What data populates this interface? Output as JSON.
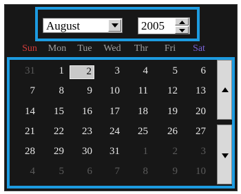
{
  "header": {
    "month": "August",
    "year": "2005"
  },
  "weekdays": [
    {
      "label": "Sun",
      "color": "#d23b3b"
    },
    {
      "label": "Mon",
      "color": "#a0a0a0"
    },
    {
      "label": "Tue",
      "color": "#a0a0a0"
    },
    {
      "label": "Wed",
      "color": "#a0a0a0"
    },
    {
      "label": "Thr",
      "color": "#a0a0a0"
    },
    {
      "label": "Fri",
      "color": "#a0a0a0"
    },
    {
      "label": "Sat",
      "color": "#7a62d6"
    }
  ],
  "calendar": {
    "selected_day": "2",
    "weeks": [
      [
        {
          "day": "31",
          "other": true
        },
        {
          "day": "1"
        },
        {
          "day": "2",
          "selected": true
        },
        {
          "day": "3"
        },
        {
          "day": "4"
        },
        {
          "day": "5"
        },
        {
          "day": "6"
        }
      ],
      [
        {
          "day": "7"
        },
        {
          "day": "8"
        },
        {
          "day": "9"
        },
        {
          "day": "10"
        },
        {
          "day": "11"
        },
        {
          "day": "12"
        },
        {
          "day": "13"
        }
      ],
      [
        {
          "day": "14"
        },
        {
          "day": "15"
        },
        {
          "day": "16"
        },
        {
          "day": "17"
        },
        {
          "day": "18"
        },
        {
          "day": "19"
        },
        {
          "day": "20"
        }
      ],
      [
        {
          "day": "21"
        },
        {
          "day": "22"
        },
        {
          "day": "23"
        },
        {
          "day": "24"
        },
        {
          "day": "25"
        },
        {
          "day": "26"
        },
        {
          "day": "27"
        }
      ],
      [
        {
          "day": "28"
        },
        {
          "day": "29"
        },
        {
          "day": "30"
        },
        {
          "day": "31"
        },
        {
          "day": "1",
          "other": true
        },
        {
          "day": "2",
          "other": true
        },
        {
          "day": "3",
          "other": true
        }
      ],
      [
        {
          "day": "4",
          "other": true
        },
        {
          "day": "5",
          "other": true
        },
        {
          "day": "6",
          "other": true
        },
        {
          "day": "7",
          "other": true
        },
        {
          "day": "8",
          "other": true
        },
        {
          "day": "9",
          "other": true
        },
        {
          "day": "10",
          "other": true
        }
      ]
    ]
  },
  "icons": {
    "month_dropdown": "chevron-down-icon",
    "year_up": "spin-up-icon",
    "year_down": "spin-down-icon",
    "scroll_up": "arrow-up-icon",
    "scroll_down": "arrow-down-icon"
  },
  "colors": {
    "background": "#171717",
    "highlight_border": "#1d9be0",
    "selected_cell": "#c9c9c9",
    "other_month_text": "#5b5b5b"
  }
}
